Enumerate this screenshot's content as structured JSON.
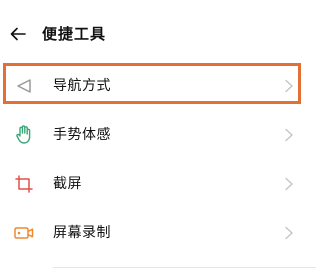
{
  "header": {
    "back_icon": "arrow-left-icon",
    "title": "便捷工具"
  },
  "items": [
    {
      "label": "导航方式",
      "icon": "navigation-triangle-icon",
      "highlighted": true
    },
    {
      "label": "手势体感",
      "icon": "hand-gesture-icon"
    },
    {
      "label": "截屏",
      "icon": "crop-icon"
    },
    {
      "label": "屏幕录制",
      "icon": "screen-record-icon"
    }
  ],
  "colors": {
    "highlight_border": "#e46f35",
    "icon_gray": "#9a9a9a",
    "icon_green": "#3aa776",
    "icon_red": "#e0524c",
    "icon_orange": "#ee8a2e",
    "chevron": "#c4c4c4"
  }
}
